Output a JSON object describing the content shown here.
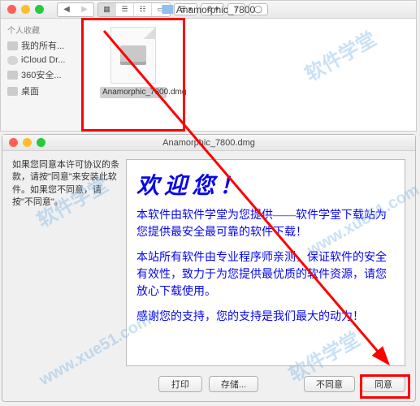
{
  "watermark": "软件学堂",
  "watermark_url": "www.xue51.com",
  "finder": {
    "title": "Anamorphic_7800",
    "sidebar": {
      "heading": "个人收藏",
      "items": [
        {
          "label": "我的所有...",
          "icon": "drive"
        },
        {
          "label": "iCloud Dr...",
          "icon": "cloud"
        },
        {
          "label": "360安全...",
          "icon": "folder"
        },
        {
          "label": "桌面",
          "icon": "desktop"
        }
      ]
    },
    "file": {
      "name": "Anamorphic_7800.dmg"
    }
  },
  "dialog": {
    "title": "Anamorphic_7800.dmg",
    "side_text": "如果您同意本许可协议的条款，请按\"同意\"来安装此软件。如果您不同意，请按\"不同意\"。",
    "license": {
      "welcome": "欢迎您！",
      "p1": "本软件由软件学堂为您提供——软件学堂下载站为您提供最安全最可靠的软件下载！",
      "p2": "本站所有软件由专业程序师亲测，保证软件的安全有效性，致力于为您提供最优质的软件资源，请您放心下载使用。",
      "p3": "感谢您的支持，您的支持是我们最大的动力！"
    },
    "buttons": {
      "print": "打印",
      "save": "存储...",
      "disagree": "不同意",
      "agree": "同意"
    }
  }
}
